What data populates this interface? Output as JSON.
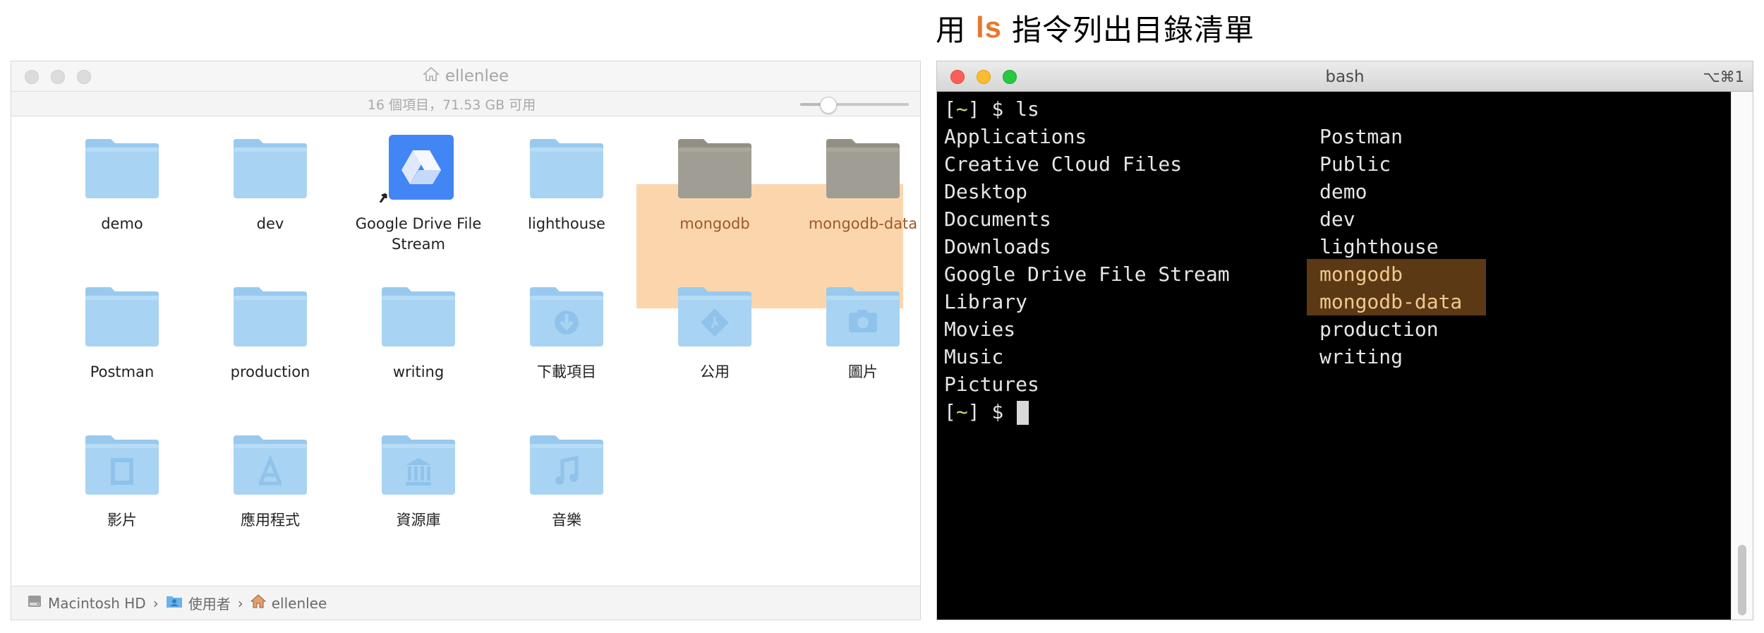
{
  "caption": {
    "prefix": "用",
    "command": "ls",
    "suffix": "指令列出目錄清單"
  },
  "finder": {
    "title": "ellenlee",
    "status": "16 個項目，71.53 GB 可用",
    "icon_size_slider": 0.25,
    "items": [
      {
        "label": "demo",
        "icon": "folder-icon",
        "selected": false
      },
      {
        "label": "dev",
        "icon": "folder-icon",
        "selected": false
      },
      {
        "label": "Google Drive File Stream",
        "icon": "google-drive-alias-icon",
        "selected": false
      },
      {
        "label": "lighthouse",
        "icon": "folder-icon",
        "selected": false
      },
      {
        "label": "mongodb",
        "icon": "folder-icon",
        "selected": true
      },
      {
        "label": "mongodb-data",
        "icon": "folder-icon",
        "selected": true
      },
      {
        "label": "Postman",
        "icon": "folder-icon",
        "selected": false
      },
      {
        "label": "production",
        "icon": "folder-icon",
        "selected": false
      },
      {
        "label": "writing",
        "icon": "folder-icon",
        "selected": false
      },
      {
        "label": "下載項目",
        "icon": "downloads-folder-icon",
        "selected": false
      },
      {
        "label": "公用",
        "icon": "public-folder-icon",
        "selected": false
      },
      {
        "label": "圖片",
        "icon": "pictures-folder-icon",
        "selected": false
      },
      {
        "label": "影片",
        "icon": "movies-folder-icon",
        "selected": false
      },
      {
        "label": "應用程式",
        "icon": "applications-folder-icon",
        "selected": false
      },
      {
        "label": "資源庫",
        "icon": "library-folder-icon",
        "selected": false
      },
      {
        "label": "音樂",
        "icon": "music-folder-icon",
        "selected": false
      }
    ],
    "path": [
      {
        "label": "Macintosh HD",
        "icon": "hard-drive-icon"
      },
      {
        "label": "使用者",
        "icon": "users-folder-icon"
      },
      {
        "label": "ellenlee",
        "icon": "home-icon"
      }
    ],
    "path_separator": "›"
  },
  "terminal": {
    "title": "bash",
    "shortcut": "⌥⌘1",
    "prompt_open": "[",
    "prompt_dir": "~",
    "prompt_close": "] $ ",
    "command": "ls",
    "column_left": [
      "Applications",
      "Creative Cloud Files",
      "Desktop",
      "Documents",
      "Downloads",
      "Google Drive File Stream",
      "Library",
      "Movies",
      "Music",
      "Pictures"
    ],
    "column_right": [
      "Postman",
      "Public",
      "demo",
      "dev",
      "lighthouse",
      "mongodb",
      "mongodb-data",
      "production",
      "writing"
    ],
    "highlighted": [
      "mongodb",
      "mongodb-data"
    ],
    "colors": {
      "highlight": "#5b3914",
      "highlight_text": "#f0c890",
      "tilde": "#c8e07a"
    }
  },
  "colors": {
    "caption_accent": "#e8772e",
    "selection": "#fbd6ad",
    "folder": "#a9d3f2"
  }
}
